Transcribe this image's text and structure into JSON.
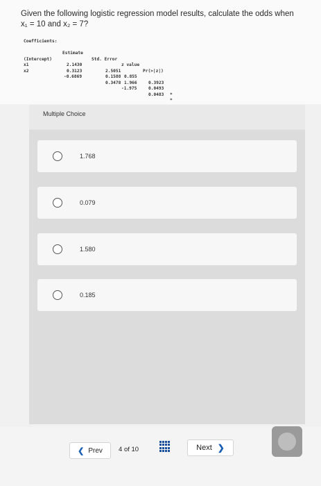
{
  "question": {
    "text_line1": "Given the following logistic regression model results, calculate the odds when",
    "text_line2": "x₁ = 10 and x₂ = 7?"
  },
  "coefficients": {
    "title": "Coefficients:",
    "headers": [
      "Estimate",
      "Std. Error",
      "z value",
      "Pr(>|z|)"
    ],
    "rows": [
      {
        "name": "(Intercept)",
        "estimate": "2.1430",
        "std_error": "2.5051",
        "z": "0.855",
        "p": "0.3923",
        "sig": ""
      },
      {
        "name": "x1",
        "estimate": "0.3123",
        "std_error": "0.1588",
        "z": "1.966",
        "p": "0.0493",
        "sig": "*"
      },
      {
        "name": "x2",
        "estimate": "-0.6869",
        "std_error": "0.3478",
        "z": "-1.975",
        "p": "0.0483",
        "sig": "*"
      }
    ]
  },
  "panel": {
    "label": "Multiple Choice",
    "choices": [
      {
        "label": "1.768"
      },
      {
        "label": "0.079"
      },
      {
        "label": "1.580"
      },
      {
        "label": "0.185"
      }
    ]
  },
  "footer": {
    "prev_label": "Prev",
    "page_current": "4",
    "page_of": "of",
    "page_total": "10",
    "next_label": "Next"
  },
  "colors": {
    "accent": "#1a5fb4",
    "grid_icon": "#1a4f9c"
  },
  "icons": {
    "prev": "chevron-left-icon",
    "next": "chevron-right-icon",
    "grid": "grid-icon"
  }
}
